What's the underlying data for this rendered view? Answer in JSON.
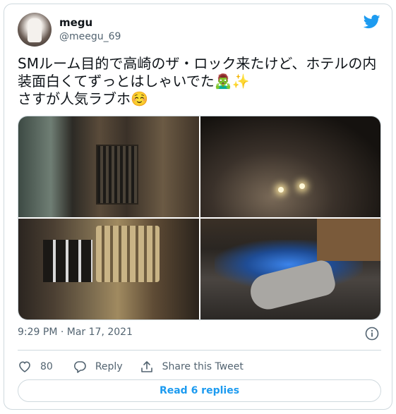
{
  "user": {
    "display_name": "megu",
    "handle": "@meegu_69"
  },
  "tweet": {
    "lines": [
      "SMルーム目的で高崎のザ・ロック来たけど、ホテルの内",
      "装面白くてずっとはしゃいでた🧟‍♂️✨",
      "さすが人気ラブホ☺️"
    ],
    "timestamp": "9:29 PM · Mar 17, 2021"
  },
  "actions": {
    "like_count": "80",
    "reply_label": "Reply",
    "share_label": "Share this Tweet"
  },
  "replies_button": "Read 6 replies",
  "icons": {
    "brand": "twitter-bird-icon",
    "info": "info-icon",
    "like": "heart-icon",
    "reply": "speech-bubble-icon",
    "share": "share-icon"
  },
  "colors": {
    "accent": "#1d9bf0",
    "muted": "#536471",
    "border": "#cfd9de"
  }
}
